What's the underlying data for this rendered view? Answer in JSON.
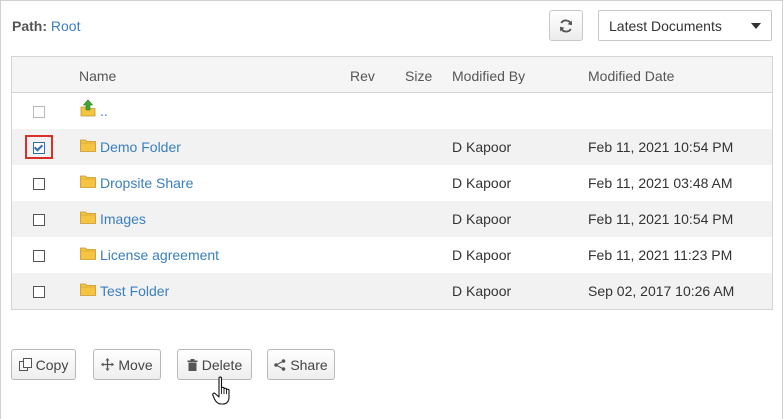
{
  "header": {
    "path_label": "Path:",
    "path_value": "Root",
    "refresh_icon": "refresh-icon",
    "view_select": {
      "selected": "Latest Documents"
    }
  },
  "table": {
    "columns": [
      "Name",
      "Rev",
      "Size",
      "Modified By",
      "Modified Date"
    ],
    "parent_row": {
      "name": "..",
      "icon": "folder-up-icon"
    },
    "rows": [
      {
        "name": "Demo Folder",
        "modified_by": "D Kapoor",
        "modified_date": "Feb 11, 2021 10:54 PM",
        "checked": true
      },
      {
        "name": "Dropsite Share",
        "modified_by": "D Kapoor",
        "modified_date": "Feb 11, 2021 03:48 AM",
        "checked": false
      },
      {
        "name": "Images",
        "modified_by": "D Kapoor",
        "modified_date": "Feb 11, 2021 10:54 PM",
        "checked": false
      },
      {
        "name": "License agreement",
        "modified_by": "D Kapoor",
        "modified_date": "Feb 11, 2021 11:23 PM",
        "checked": false
      },
      {
        "name": "Test Folder",
        "modified_by": "D Kapoor",
        "modified_date": "Sep 02, 2017 10:26 AM",
        "checked": false
      }
    ]
  },
  "actions": {
    "copy": "Copy",
    "move": "Move",
    "delete": "Delete",
    "share": "Share"
  },
  "colors": {
    "link": "#3a7fc1",
    "focus_outline": "#d9302b",
    "folder": "#f5c542"
  }
}
